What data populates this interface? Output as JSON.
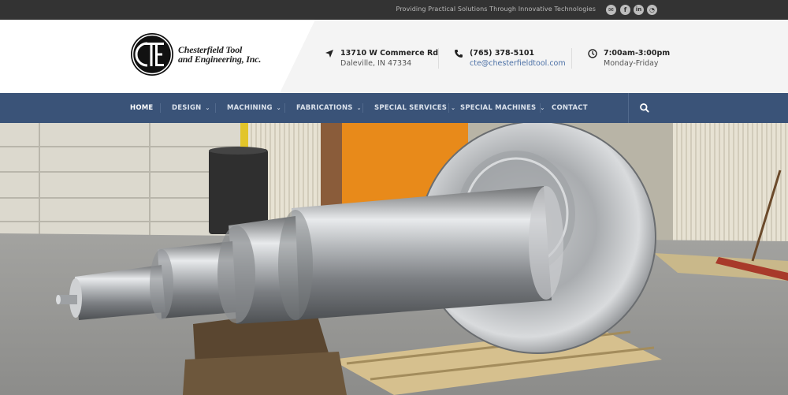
{
  "topbar": {
    "tagline": "Providing Practical Solutions Through Innovative Technologies",
    "social": [
      {
        "name": "email-icon",
        "glyph": "✉"
      },
      {
        "name": "facebook-icon",
        "glyph": "f"
      },
      {
        "name": "linkedin-icon",
        "glyph": "in"
      },
      {
        "name": "rss-icon",
        "glyph": "◔"
      }
    ]
  },
  "header": {
    "logo_text": "CTE",
    "company_line1": "Chesterfield Tool",
    "company_line2": "and Engineering, Inc.",
    "address": {
      "icon": "location-arrow-icon",
      "line1": "13710 W Commerce Rd",
      "line2": "Daleville, IN 47334"
    },
    "contact": {
      "icon": "phone-icon",
      "line1": "(765) 378-5101",
      "line2": "cte@chesterfieldtool.com"
    },
    "hours": {
      "icon": "clock-icon",
      "line1": "7:00am-3:00pm",
      "line2": "Monday-Friday"
    }
  },
  "nav": {
    "items": [
      {
        "label": "HOME",
        "has_dropdown": false,
        "active": true
      },
      {
        "label": "DESIGN",
        "has_dropdown": true,
        "active": false
      },
      {
        "label": "MACHINING",
        "has_dropdown": true,
        "active": false
      },
      {
        "label": "FABRICATIONS",
        "has_dropdown": true,
        "active": false
      },
      {
        "label": "SPECIAL SERVICES",
        "has_dropdown": true,
        "active": false
      },
      {
        "label": "SPECIAL MACHINES",
        "has_dropdown": true,
        "active": false
      },
      {
        "label": "CONTACT",
        "has_dropdown": false,
        "active": false
      }
    ],
    "search_icon": "search-icon"
  },
  "hero": {
    "image": "machined-steel-shaft-photo"
  },
  "colors": {
    "topbar_bg": "#333333",
    "nav_bg": "#3a5378",
    "link": "#4a6fa5"
  }
}
